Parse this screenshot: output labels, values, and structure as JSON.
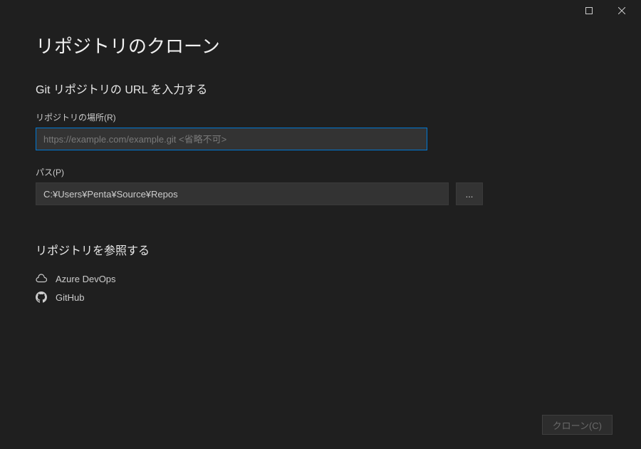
{
  "title": "リポジトリのクローン",
  "section_title": "Git リポジトリの URL を入力する",
  "repo_location": {
    "label": "リポジトリの場所(R)",
    "placeholder": "https://example.com/example.git <省略不可>",
    "value": ""
  },
  "path": {
    "label": "パス(P)",
    "value": "C:¥Users¥Penta¥Source¥Repos",
    "browse_label": "..."
  },
  "browse_section": {
    "title": "リポジトリを参照する",
    "items": [
      {
        "label": "Azure DevOps",
        "icon": "cloud"
      },
      {
        "label": "GitHub",
        "icon": "github"
      }
    ]
  },
  "footer": {
    "clone_label": "クローン(C)"
  }
}
